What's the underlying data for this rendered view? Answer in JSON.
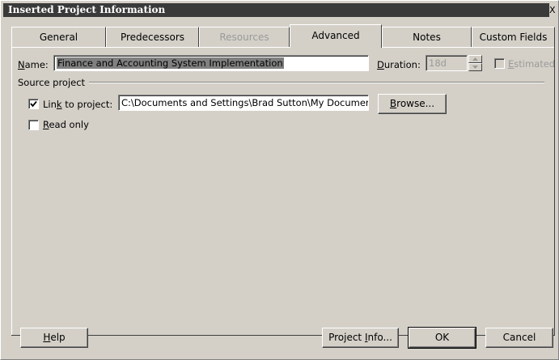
{
  "window": {
    "title": "Inserted Project Information",
    "close_label": "X"
  },
  "tabs": [
    {
      "label": "General",
      "state": "normal"
    },
    {
      "label": "Predecessors",
      "state": "normal"
    },
    {
      "label": "Resources",
      "state": "disabled"
    },
    {
      "label": "Advanced",
      "state": "active"
    },
    {
      "label": "Notes",
      "state": "normal"
    },
    {
      "label": "Custom Fields",
      "state": "normal"
    }
  ],
  "name_field": {
    "label_accel": "N",
    "label_rest": "ame:",
    "value": "Finance and Accounting System Implementation"
  },
  "duration_field": {
    "label_accel": "D",
    "label_rest": "uration:",
    "value": "18d"
  },
  "estimated": {
    "label_accel": "E",
    "label_rest": "stimated",
    "checked": false,
    "enabled": false
  },
  "source_project": {
    "group_label": "Source project",
    "link": {
      "label_pre": "Lin",
      "label_accel": "k",
      "label_post": " to project:",
      "checked": true,
      "path": "C:\\Documents and Settings\\Brad Sutton\\My Documents\\"
    },
    "browse": {
      "accel": "B",
      "rest": "rowse..."
    },
    "read_only": {
      "label_accel": "R",
      "label_rest": "ead only",
      "checked": false
    }
  },
  "buttons": {
    "help": {
      "accel": "H",
      "rest": "elp"
    },
    "project_info": {
      "pre": "Project ",
      "accel": "I",
      "post": "nfo..."
    },
    "ok": "OK",
    "cancel": "Cancel"
  },
  "colors": {
    "face": "#d4d0c8",
    "titlebar": "#3a3a3a",
    "selection": "#808080",
    "disabled_text": "#9a9a9a"
  }
}
